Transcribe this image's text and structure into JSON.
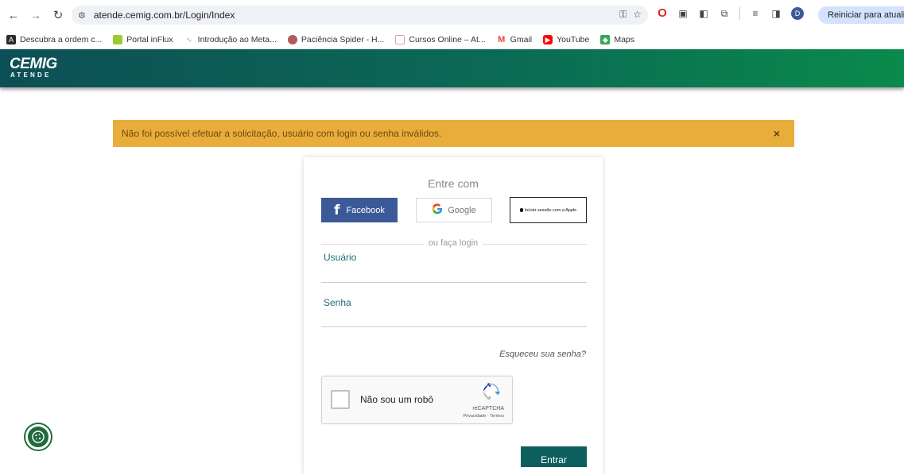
{
  "browser": {
    "url": "atende.cemig.com.br/Login/Index",
    "update_button": "Reiniciar para atualizar",
    "avatar_letter": "D",
    "bookmarks": [
      {
        "label": "Descubra a ordem c...",
        "color": "#2b2b2b"
      },
      {
        "label": "Portal inFlux",
        "color": "#9acd32"
      },
      {
        "label": "Introdução ao Meta...",
        "color": "#7fb3d5"
      },
      {
        "label": "Paciência Spider - H...",
        "color": "#b25b5b"
      },
      {
        "label": "Cursos Online – At...",
        "color": "#e0a0b0"
      },
      {
        "label": "Gmail",
        "color": "#ea4335"
      },
      {
        "label": "YouTube",
        "color": "#ff0000"
      },
      {
        "label": "Maps",
        "color": "#34a853"
      }
    ]
  },
  "header": {
    "logo_main": "CEMIG",
    "logo_sub": "ATENDE"
  },
  "alert": {
    "message": "Não foi possível efetuar a solicitação, usuário com login ou senha inválidos.",
    "close": "×",
    "color": "#e9ad3b"
  },
  "login": {
    "title": "Entre com",
    "facebook_label": "Facebook",
    "google_label": "Google",
    "apple_label": "Iniciar sessão com a Apple",
    "divider": "ou faça login",
    "username_label": "Usuário",
    "username_value": "",
    "password_label": "Senha",
    "password_value": "",
    "forgot": "Esqueceu sua senha?",
    "submit": "Entrar"
  },
  "recaptcha": {
    "label": "Não sou um robô",
    "brand": "reCAPTCHA",
    "links": "Privacidade - Termos"
  }
}
